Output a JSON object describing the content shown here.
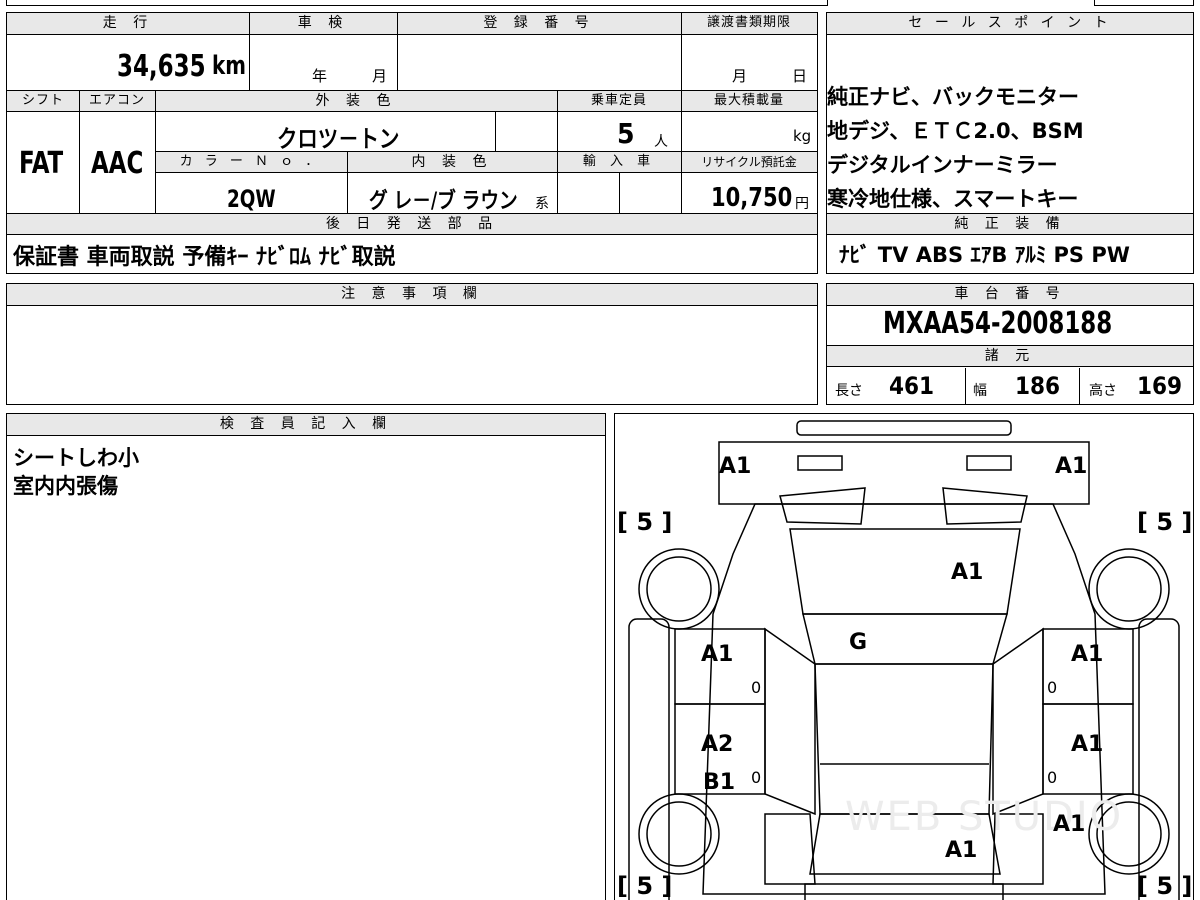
{
  "top_headers": {
    "mileage": "走 行",
    "inspection": "車 検",
    "registration": "登 録 番 号",
    "transfer_deadline": "譲渡書類期限",
    "sales_point": "セ ー ル ス ポ イ ン ト"
  },
  "mileage": {
    "value": "34,635",
    "unit": "km"
  },
  "inspection": {
    "year_label": "年",
    "month_label": "月"
  },
  "transfer": {
    "month_label": "月",
    "day_label": "日"
  },
  "row2_headers": {
    "shift": "シフト",
    "aircon": "エアコン",
    "exterior_color": "外 装 色",
    "capacity": "乗車定員",
    "max_load": "最大積載量"
  },
  "shift": "FAT",
  "aircon": "AAC",
  "exterior_color": "クロツ－トン",
  "capacity": {
    "value": "5",
    "unit": "人"
  },
  "max_load": {
    "unit": "kg"
  },
  "row3_headers": {
    "color_no": "カ ラ ー Ｎ ｏ ．",
    "interior_color": "内 装 色",
    "import": "輸 入 車",
    "recycle": "リサイクル預託金"
  },
  "color_no": "2QW",
  "interior_color": {
    "value": "グ レ－/ブ ラウン",
    "suffix": "系"
  },
  "recycle": {
    "value": "10,750",
    "unit": "円"
  },
  "sales_points": [
    "純正ナビ、バックモニター",
    "地デジ、ＥＴＣ2.0、BSM",
    "デジタルインナーミラー",
    "寒冷地仕様、スマートキー"
  ],
  "later_shipping": {
    "header": "後 日 発 送 部 品",
    "items": "保証書 車両取説 予備ｷｰ ﾅﾋﾞﾛﾑ ﾅﾋﾞ取説"
  },
  "genuine_equipment": {
    "header": "純 正 装 備",
    "items": "ﾅﾋﾞ TV ABS ｴｱB ｱﾙﾐ PS PW"
  },
  "notes": {
    "header": "注 意 事 項 欄"
  },
  "chassis": {
    "header": "車 台 番 号",
    "value": "MXAA54-2008188"
  },
  "specs": {
    "header": "諸 元",
    "length_label": "長さ",
    "length": "461",
    "width_label": "幅",
    "width": "186",
    "height_label": "高さ",
    "height": "169"
  },
  "inspector": {
    "header": "検 査 員 記 入 欄",
    "lines": [
      "シートしわ小",
      "室内内張傷"
    ]
  },
  "diagram": {
    "front_left_corner": "A1",
    "front_right_corner": "A1",
    "hood": "A1",
    "windshield": "G",
    "front_left_door": "A1",
    "front_right_door": "A1",
    "rear_left_door_1": "A2",
    "rear_left_door_2": "B1",
    "rear_right_door": "A1",
    "rear_right_quarter": "A1",
    "roof_rear": "A1",
    "tire_fl": "5",
    "tire_fr": "5",
    "tire_rl": "5",
    "tire_rr": "5",
    "door_marks": "0",
    "watermark": "WEB STUDIO"
  }
}
